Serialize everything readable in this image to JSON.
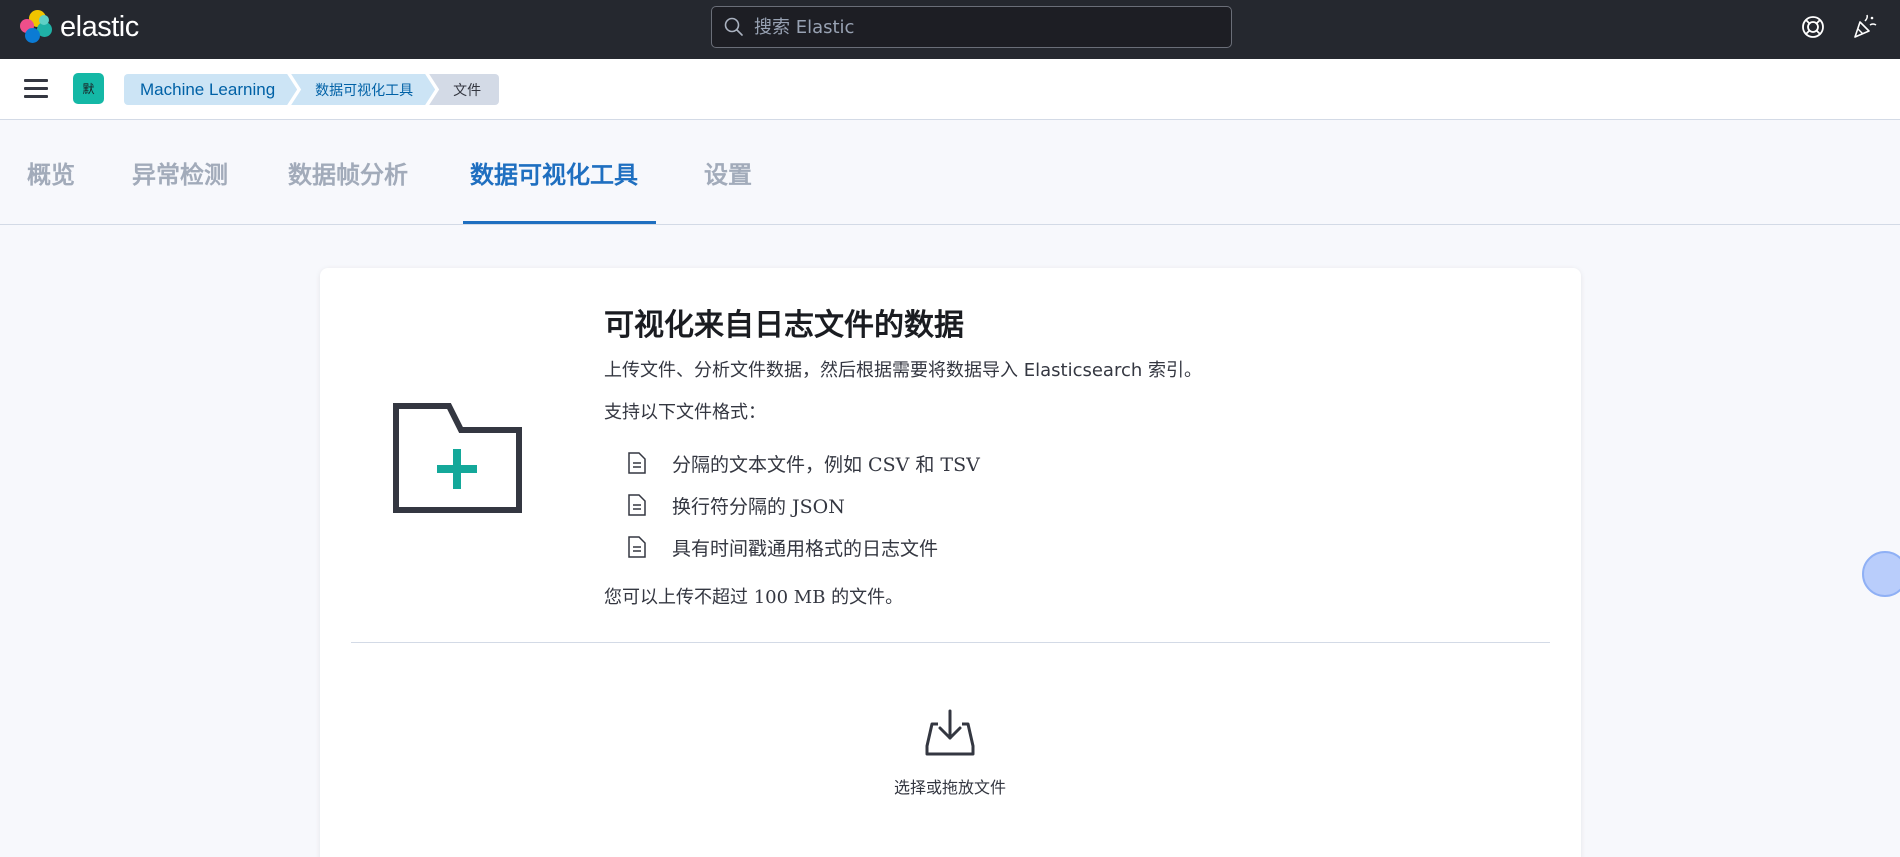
{
  "topbar": {
    "logo_text": "elastic",
    "search_placeholder": "搜索 Elastic"
  },
  "navbar": {
    "space_avatar": "默",
    "breadcrumbs": [
      "Machine Learning",
      "数据可视化工具",
      "文件"
    ]
  },
  "tabs": [
    {
      "label": "概览",
      "active": false
    },
    {
      "label": "异常检测",
      "active": false
    },
    {
      "label": "数据帧分析",
      "active": false
    },
    {
      "label": "数据可视化工具",
      "active": true
    },
    {
      "label": "设置",
      "active": false
    }
  ],
  "card": {
    "title": "可视化来自日志文件的数据",
    "description_prefix": "上传文件、分析文件数据，然后根据需要将数据导入 ",
    "description_product": "Elasticsearch",
    "description_suffix": " 索引。",
    "supported_label": "支持以下文件格式：",
    "formats": [
      {
        "label": "分隔的文本文件，例如 CSV 和 TSV",
        "icon": "document-icon"
      },
      {
        "label": "换行符分隔的 JSON",
        "icon": "document-icon"
      },
      {
        "label": "具有时间戳通用格式的日志文件",
        "icon": "document-icon"
      }
    ],
    "limit_text": "您可以上传不超过 100 MB 的文件。",
    "dropzone_label": "选择或拖放文件"
  },
  "colors": {
    "header_bg": "#25282f",
    "accent": "#1f6fc0",
    "teal": "#14a89a"
  }
}
